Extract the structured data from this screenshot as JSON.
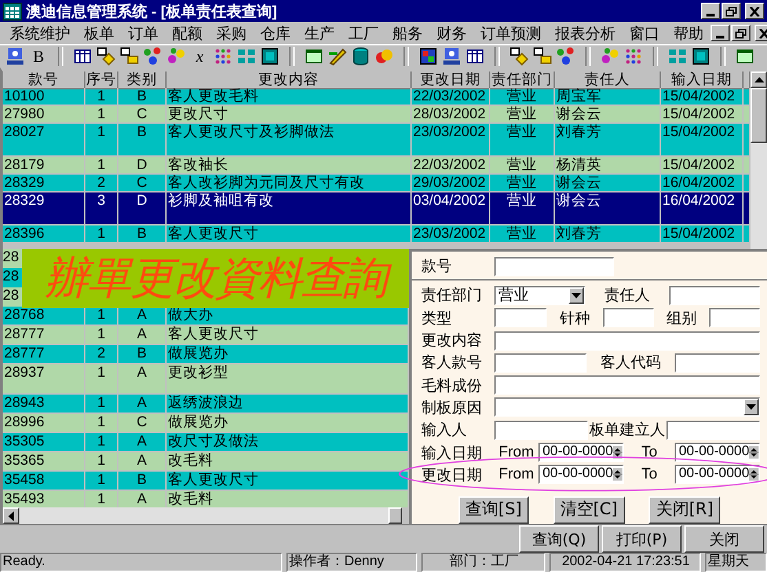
{
  "window": {
    "title": "澳迪信息管理系统 - [板单责任表查询]"
  },
  "menu": [
    "系统维护",
    "板单",
    "订单",
    "配额",
    "采购",
    "仓库",
    "生产",
    "工厂",
    "船务",
    "财务",
    "订单预测",
    "报表分析",
    "窗口",
    "帮助"
  ],
  "toolbar": [
    {
      "kind": "icon"
    },
    {
      "kind": "text",
      "label": "B"
    },
    {
      "kind": "separator"
    },
    {
      "kind": "icon"
    },
    {
      "kind": "icon"
    },
    {
      "kind": "icon"
    },
    {
      "kind": "icon"
    },
    {
      "kind": "icon"
    },
    {
      "kind": "text",
      "label": "x"
    },
    {
      "kind": "icon"
    },
    {
      "kind": "icon"
    },
    {
      "kind": "icon"
    },
    {
      "kind": "separator"
    },
    {
      "kind": "icon"
    },
    {
      "kind": "icon"
    },
    {
      "kind": "icon"
    },
    {
      "kind": "icon"
    },
    {
      "kind": "separator"
    },
    {
      "kind": "icon"
    },
    {
      "kind": "icon"
    },
    {
      "kind": "icon"
    },
    {
      "kind": "separator"
    },
    {
      "kind": "icon"
    },
    {
      "kind": "icon"
    },
    {
      "kind": "icon"
    },
    {
      "kind": "separator"
    },
    {
      "kind": "icon"
    },
    {
      "kind": "icon"
    },
    {
      "kind": "separator"
    },
    {
      "kind": "icon"
    },
    {
      "kind": "icon"
    },
    {
      "kind": "separator"
    },
    {
      "kind": "icon"
    }
  ],
  "table": {
    "columns": [
      "款号",
      "序号",
      "类别",
      "更改内容",
      "更改日期",
      "责任部门",
      "责任人",
      "输入日期"
    ],
    "rows": [
      {
        "kind": "normal",
        "selected": false,
        "cells": [
          "10100",
          "1",
          "B",
          "客人更改毛料",
          "22/03/2002",
          "营业",
          "周宝军",
          "15/04/2002"
        ]
      },
      {
        "kind": "normal",
        "selected": false,
        "cells": [
          "27980",
          "1",
          "C",
          "更改尺寸",
          "28/03/2002",
          "营业",
          "谢会云",
          "15/04/2002"
        ]
      },
      {
        "kind": "tall",
        "selected": false,
        "cells": [
          "28027",
          "1",
          "B",
          "客人更改尺寸及衫脚做法",
          "23/03/2002",
          "营业",
          "刘春芳",
          "15/04/2002"
        ]
      },
      {
        "kind": "normal",
        "selected": false,
        "cells": [
          "28179",
          "1",
          "D",
          "客改袖长",
          "22/03/2002",
          "营业",
          "杨清英",
          "15/04/2002"
        ]
      },
      {
        "kind": "normal",
        "selected": false,
        "cells": [
          "28329",
          "2",
          "C",
          "客人改衫脚为元同及尺寸有改",
          "29/03/2002",
          "营业",
          "谢会云",
          "16/04/2002"
        ]
      },
      {
        "kind": "tall",
        "selected": true,
        "cells": [
          "28329",
          "3",
          "D",
          "衫脚及袖咀有改",
          "03/04/2002",
          "营业",
          "谢会云",
          "16/04/2002"
        ]
      },
      {
        "kind": "normal",
        "selected": false,
        "cells": [
          "28396",
          "1",
          "B",
          "客人更改尺寸",
          "23/03/2002",
          "营业",
          "刘春芳",
          "15/04/2002"
        ]
      }
    ]
  },
  "covered_rows": [
    {
      "kind": "covered",
      "cells": [
        "28"
      ]
    },
    {
      "kind": "covered",
      "cells": [
        "28"
      ]
    },
    {
      "kind": "covered",
      "cells": [
        "28"
      ]
    },
    {
      "kind": "normal",
      "cells": [
        "28768",
        "1",
        "A",
        "做大办"
      ]
    },
    {
      "kind": "normal",
      "cells": [
        "28777",
        "1",
        "A",
        "客人更改尺寸"
      ]
    },
    {
      "kind": "normal",
      "cells": [
        "28777",
        "2",
        "B",
        "做展览办"
      ]
    },
    {
      "kind": "tall",
      "cells": [
        "28937",
        "1",
        "A",
        "更改衫型"
      ]
    },
    {
      "kind": "normal",
      "cells": [
        "28943",
        "1",
        "A",
        "返绣波浪边"
      ]
    },
    {
      "kind": "normal",
      "cells": [
        "28996",
        "1",
        "C",
        "做展览办"
      ]
    },
    {
      "kind": "normal",
      "cells": [
        "35305",
        "1",
        "A",
        "改尺寸及做法"
      ]
    },
    {
      "kind": "normal",
      "cells": [
        "35365",
        "1",
        "A",
        "改毛料"
      ]
    },
    {
      "kind": "normal",
      "cells": [
        "35458",
        "1",
        "B",
        "客人更改尺寸"
      ]
    },
    {
      "kind": "normal",
      "cells": [
        "35493",
        "1",
        "A",
        "改毛料"
      ]
    }
  ],
  "banner": {
    "title": "辦單更改資料查詢"
  },
  "query_form": {
    "rows": [
      {
        "highlighted": false,
        "items": [
          {
            "kind": "label",
            "text": "款号"
          },
          {
            "kind": "field"
          }
        ]
      },
      {
        "highlighted": false,
        "items": [
          {
            "kind": "label",
            "text": "责任部门"
          },
          {
            "kind": "select",
            "value": "营业"
          },
          {
            "kind": "label",
            "text": "责任人"
          },
          {
            "kind": "field"
          }
        ]
      },
      {
        "highlighted": false,
        "items": [
          {
            "kind": "label",
            "text": "类型"
          },
          {
            "kind": "field"
          },
          {
            "kind": "label",
            "text": "针种"
          },
          {
            "kind": "field"
          },
          {
            "kind": "label",
            "text": "组别"
          },
          {
            "kind": "field"
          }
        ]
      },
      {
        "highlighted": false,
        "items": [
          {
            "kind": "label",
            "text": "更改内容"
          },
          {
            "kind": "field"
          }
        ]
      },
      {
        "highlighted": false,
        "items": [
          {
            "kind": "label",
            "text": "客人款号"
          },
          {
            "kind": "field"
          },
          {
            "kind": "label",
            "text": "客人代码"
          },
          {
            "kind": "field"
          }
        ]
      },
      {
        "highlighted": false,
        "items": [
          {
            "kind": "label",
            "text": "毛料成份"
          },
          {
            "kind": "field"
          }
        ]
      },
      {
        "highlighted": false,
        "items": [
          {
            "kind": "label",
            "text": "制板原因"
          },
          {
            "kind": "select"
          }
        ]
      },
      {
        "highlighted": false,
        "items": [
          {
            "kind": "label",
            "text": "输入人"
          },
          {
            "kind": "field"
          },
          {
            "kind": "label",
            "text": "板单建立人"
          },
          {
            "kind": "field"
          }
        ]
      },
      {
        "highlighted": false,
        "items": [
          {
            "kind": "label",
            "text": "输入日期"
          },
          {
            "kind": "label",
            "text": "From"
          },
          {
            "kind": "spin",
            "value": "00-00-0000"
          },
          {
            "kind": "label",
            "text": "To"
          },
          {
            "kind": "spin",
            "value": "00-00-0000"
          }
        ]
      },
      {
        "highlighted": true,
        "items": [
          {
            "kind": "label",
            "text": "更改日期"
          },
          {
            "kind": "label",
            "text": "From"
          },
          {
            "kind": "spin",
            "value": "00-00-0000"
          },
          {
            "kind": "label",
            "text": "To"
          },
          {
            "kind": "spin",
            "value": "00-00-0000"
          }
        ]
      }
    ],
    "buttons": [
      "查询[S]",
      "清空[C]",
      "关闭[R]"
    ]
  },
  "action_bar": {
    "buttons": [
      "查询(Q)",
      "打印(P)",
      "关闭"
    ]
  },
  "status_bar": [
    "Ready.",
    "操作者：Denny",
    "部门：工厂",
    "2002-04-21 17:23:51",
    "星期天"
  ]
}
